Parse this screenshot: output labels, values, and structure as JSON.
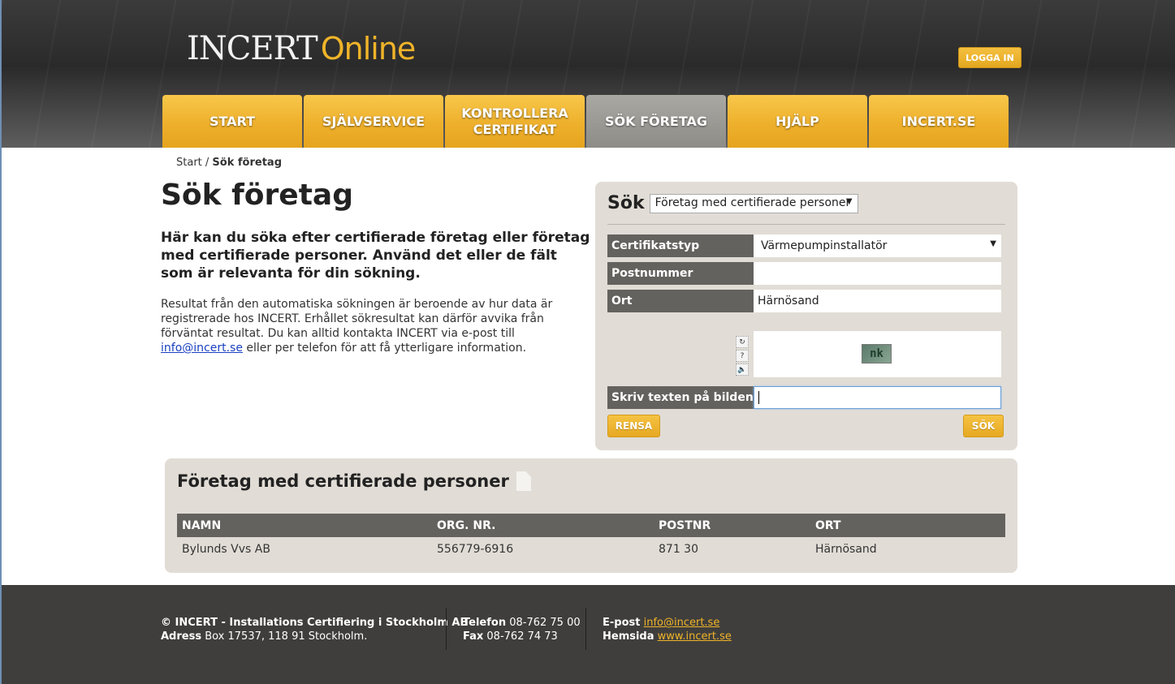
{
  "header": {
    "logo_main": "INCERT",
    "logo_online": "Online",
    "login_label": "LOGGA IN"
  },
  "nav": [
    {
      "label": "START"
    },
    {
      "label": "SJÄLVSERVICE"
    },
    {
      "label": "KONTROLLERA CERTIFIKAT"
    },
    {
      "label": "SÖK FÖRETAG",
      "active": true
    },
    {
      "label": "HJÄLP"
    },
    {
      "label": "INCERT.SE"
    }
  ],
  "breadcrumb": {
    "home": "Start",
    "separator": " / ",
    "current": "Sök företag"
  },
  "main": {
    "title": "Sök företag",
    "lead": "Här kan du söka efter certifierade företag eller företag med certifierade personer. Använd det eller de fält som är relevanta för din sökning.",
    "body_before_link": "Resultat från den automatiska sökningen är beroende av hur data är registrerade hos INCERT. Erhållet sökresultat kan därför avvika från förväntat resultat. Du kan alltid kontakta INCERT via e-post till ",
    "body_link": "info@incert.se",
    "body_after_link": " eller per telefon för att få ytterligare information."
  },
  "search": {
    "label": "Sök",
    "mode_selected": "Företag med certifierade personer",
    "fields": {
      "cert_type_label": "Certifikatstyp",
      "cert_type_value": "Värmepumpinstallatör",
      "postnr_label": "Postnummer",
      "postnr_value": "",
      "ort_label": "Ort",
      "ort_value": "Härnösand",
      "captcha_label": "Skriv texten på bilden",
      "captcha_value": ""
    },
    "captcha_image_text": "nk",
    "clear_label": "RENSA",
    "submit_label": "SÖK"
  },
  "results": {
    "title": "Företag med certifierade personer",
    "columns": [
      "NAMN",
      "ORG. NR.",
      "POSTNR",
      "ORT"
    ],
    "rows": [
      [
        "Bylunds Vvs AB",
        "556779-6916",
        "871 30",
        "Härnösand"
      ]
    ]
  },
  "footer": {
    "company": "© INCERT - Installations Certifiering i Stockholm AB",
    "address_label": "Adress",
    "address_value": " Box 17537, 118 91 Stockholm.",
    "phone_label": "Telefon",
    "phone_value": " 08-762 75 00",
    "fax_label": "Fax",
    "fax_value": " 08-762 74 73",
    "email_label": "E-post",
    "email_value": "info@incert.se",
    "web_label": "Hemsida",
    "web_value": "www.incert.se"
  },
  "colors": {
    "accent": "#f0b429",
    "nav_active": "#8e8c87",
    "panel_bg": "#e1ddd6",
    "label_bg": "#64625e",
    "footer_bg": "#3f3e3c"
  }
}
